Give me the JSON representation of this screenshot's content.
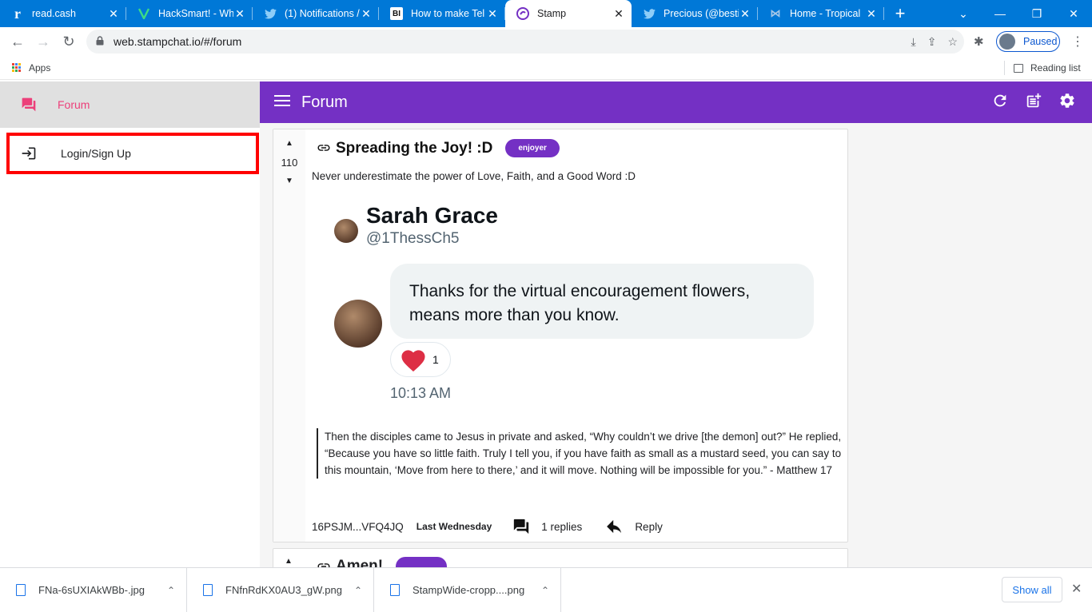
{
  "browser": {
    "tabs": [
      {
        "title": "read.cash",
        "favicon": "r",
        "active": false
      },
      {
        "title": "HackSmart! - Wh",
        "favicon": "hacksmart-icon",
        "active": false
      },
      {
        "title": "(1) Notifications /",
        "favicon": "twitter-icon",
        "active": false
      },
      {
        "title": "How to make Tel",
        "favicon": "BI",
        "active": false
      },
      {
        "title": "Stamp",
        "favicon": "stamp-icon",
        "active": true
      },
      {
        "title": "Precious (@besti",
        "favicon": "twitter-icon",
        "active": false
      },
      {
        "title": "Home - Tropical",
        "favicon": "butterfly-icon",
        "active": false
      }
    ],
    "url": "web.stampchat.io/#/forum",
    "profile_label": "Paused",
    "bookmarks": {
      "apps_label": "Apps",
      "reading_list_label": "Reading list"
    }
  },
  "sidebar": {
    "items": [
      {
        "label": "Forum",
        "icon": "forum-icon",
        "active": true
      },
      {
        "label": "Login/Sign Up",
        "icon": "login-icon",
        "active": false
      }
    ]
  },
  "appbar": {
    "title": "Forum"
  },
  "posts": [
    {
      "score": "110",
      "title": "Spreading the Joy! :D",
      "badge": "enjoyer",
      "subtitle": "Never underestimate the power of Love, Faith, and a Good Word :D",
      "tweet": {
        "name": "Sarah Grace",
        "handle": "@1ThessCh5",
        "text_line1": "Thanks for the virtual encouragement flowers,",
        "text_line2": "means more than you know.",
        "reaction_count": "1",
        "time": "10:13 AM"
      },
      "quote": "Then the disciples came to Jesus in private and asked, “Why couldn’t we drive [the demon] out?” He replied, “Because you have so little faith. Truly I tell you, if you have faith as small as a mustard seed, you can say to this mountain, ‘Move from here to there,’ and it will move. Nothing will be impossible for you.” - Matthew 17",
      "author": "16PSJM...VFQ4JQ",
      "date": "Last Wednesday",
      "replies": "1 replies",
      "reply_label": "Reply"
    },
    {
      "title": "Amen!"
    }
  ],
  "downloads": {
    "items": [
      "FNa-6sUXIAkWBb-.jpg",
      "FNfnRdKX0AU3_gW.png",
      "StampWide-cropp....png"
    ],
    "show_all_label": "Show all"
  },
  "colors": {
    "appbar": "#7430c4",
    "accent_pink": "#ec407a",
    "highlight_box": "#ff0000",
    "chrome_blue": "#0078d7"
  }
}
